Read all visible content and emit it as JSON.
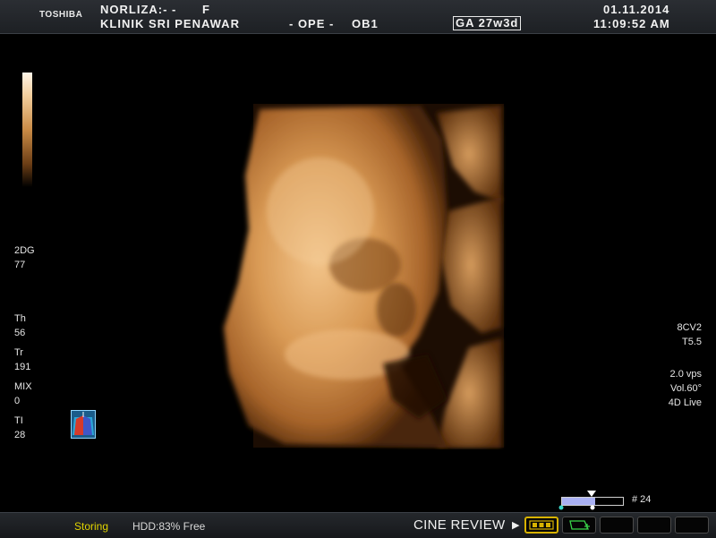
{
  "header": {
    "brand": "TOSHIBA",
    "patient_name": "NORLIZA:- -",
    "sex": "F",
    "institution": "KLINIK SRI PENAWAR",
    "mode_op": "- OPE -",
    "preset": "OB1",
    "gestational_age": "GA  27w3d",
    "date": "01.11.2014",
    "time": "11:09:52 AM"
  },
  "left_panel": {
    "items": [
      {
        "label": "2DG",
        "value": "77"
      },
      {
        "label": "Th",
        "value": "56"
      },
      {
        "label": "Tr",
        "value": "191"
      },
      {
        "label": "MIX",
        "value": "0"
      },
      {
        "label": "TI",
        "value": "28"
      }
    ]
  },
  "right_panel": {
    "probe": "8CV2",
    "t_value": "T5.5",
    "vps": "2.0 vps",
    "volume": "Vol.60°",
    "mode": "4D Live"
  },
  "cine": {
    "frame": "# 24",
    "position_fraction": 0.55
  },
  "footer": {
    "status": "Storing",
    "hdd": "HDD:83% Free",
    "cine_review": "CINE REVIEW"
  },
  "colors": {
    "render_tint": "#c67a35",
    "status_yellow": "#e0d300",
    "active_button_border": "#d8b200",
    "cine_fill": "#a9b0f2"
  },
  "icons": {
    "orientation": "orientation-cube-icon",
    "cine_play": "play-arrow-icon",
    "film": "film-strip-icon",
    "roi": "roi-box-icon"
  }
}
